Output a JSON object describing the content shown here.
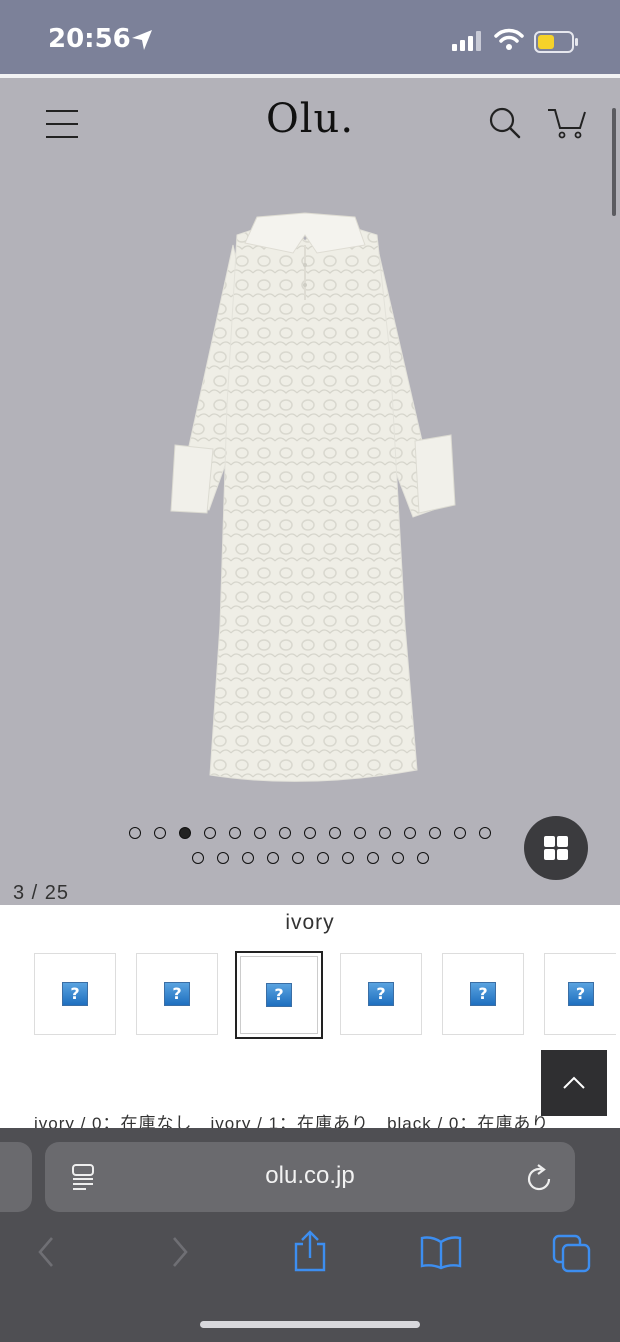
{
  "status_bar": {
    "time": "20:56",
    "icons": [
      "location-arrow-icon",
      "signal-icon",
      "wifi-icon",
      "battery-icon"
    ],
    "battery_color": "#f5d22a"
  },
  "header": {
    "brand": "Olu.",
    "icons": [
      "menu-icon",
      "search-icon",
      "cart-icon"
    ]
  },
  "carousel": {
    "total_dots": 25,
    "active_index": 3,
    "counter": "3 / 25"
  },
  "product": {
    "color_label": "ivory",
    "swatch_count": 6,
    "selected_swatch": 3,
    "stock_items": [
      "ivory / 0：在庫なし",
      "ivory / 1：在庫あり",
      "black / 0：在庫あり"
    ]
  },
  "browser": {
    "url": "olu.co.jp",
    "toolbar_icons": [
      "back-icon",
      "forward-icon",
      "share-icon",
      "bookmarks-icon",
      "tabs-icon"
    ],
    "accent": "#3d8ef0"
  }
}
